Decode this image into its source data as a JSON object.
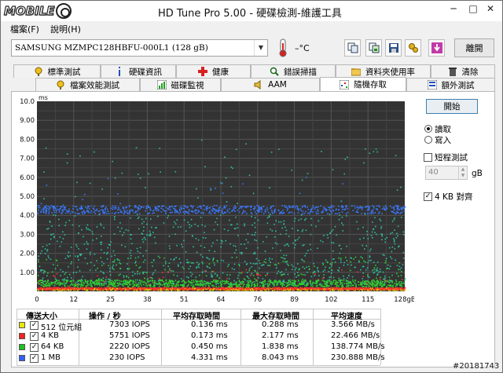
{
  "app": {
    "title": "HD Tune Pro  5.00 - 硬碟檢測-維護工具",
    "logo_text": "MOBILE",
    "window_controls": {
      "minimize": "─",
      "maximize": "□",
      "close": "✕"
    }
  },
  "menu": {
    "file": "檔案(F)",
    "help": "說明(H)"
  },
  "toolbar": {
    "drive": "SAMSUNG MZMPC128HBFU-000L1 (128 gB)",
    "temperature": "–°C",
    "exit_label": "離開",
    "icons": [
      "copy-icon",
      "copy-screenshot-icon",
      "save-icon",
      "options-icon",
      "download-icon"
    ]
  },
  "tabs": {
    "row1": [
      {
        "label": "標準測試",
        "icon": "benchmark-icon"
      },
      {
        "label": "硬碟資訊",
        "icon": "info-icon"
      },
      {
        "label": "健康",
        "icon": "health-icon"
      },
      {
        "label": "錯誤掃描",
        "icon": "scan-icon"
      },
      {
        "label": "資料夾使用率",
        "icon": "folder-icon"
      },
      {
        "label": "清除",
        "icon": "trash-icon"
      }
    ],
    "row2": [
      {
        "label": "檔案效能測試",
        "icon": "file-benchmark-icon"
      },
      {
        "label": "磁碟監視",
        "icon": "monitor-icon"
      },
      {
        "label": "AAM",
        "icon": "speaker-icon"
      },
      {
        "label": "隨機存取",
        "icon": "random-access-icon",
        "active": true
      },
      {
        "label": "額外測試",
        "icon": "extra-tests-icon"
      }
    ]
  },
  "controls": {
    "start": "開始",
    "read": "讀取",
    "write": "寫入",
    "short_stroke": "短程測試",
    "stroke_value": "40",
    "stroke_unit": "gB",
    "align": "4 KB 對齊",
    "read_selected": true,
    "align_checked": true
  },
  "chart_data": {
    "type": "scatter",
    "ylabel": "ms",
    "ylim": [
      0,
      10
    ],
    "y_ticks": [
      "10.0",
      "9.00",
      "8.00",
      "7.00",
      "6.00",
      "5.00",
      "4.00",
      "3.00",
      "2.00",
      "1.00"
    ],
    "x_ticks": [
      "0",
      "12",
      "25",
      "38",
      "51",
      "64",
      "76",
      "89",
      "102",
      "115",
      "128gB"
    ],
    "xlim": [
      0,
      128
    ],
    "background": "#333333",
    "grid": true,
    "series": [
      {
        "name": "512 位元組",
        "color": "#e8e800",
        "band_ms": 0.14,
        "max_ms": 0.29
      },
      {
        "name": "4 KB",
        "color": "#ff3030",
        "band_ms": 0.17,
        "max_ms": 2.18
      },
      {
        "name": "64 KB",
        "color": "#30d030",
        "band_ms": 0.45,
        "max_ms": 1.84
      },
      {
        "name": "1 MB",
        "color": "#3a78ff",
        "band_ms": 4.33,
        "max_ms": 8.04
      }
    ],
    "scatter_color": "#2fbf9f"
  },
  "results": {
    "headers": [
      "傳送大小",
      "操作 / 秒",
      "平均存取時間",
      "最大存取時間",
      "平均速度"
    ],
    "rows": [
      {
        "size": "512 位元組",
        "ops": "7303 IOPS",
        "avg": "0.136 ms",
        "max": "0.288 ms",
        "speed": "3.566 MB/s",
        "color": "#e8e800"
      },
      {
        "size": "4 KB",
        "ops": "5751 IOPS",
        "avg": "0.173 ms",
        "max": "2.177 ms",
        "speed": "22.466 MB/s",
        "color": "#ff2020"
      },
      {
        "size": "64 KB",
        "ops": "2220 IOPS",
        "avg": "0.450 ms",
        "max": "1.838 ms",
        "speed": "138.774 MB/s",
        "color": "#20c020"
      },
      {
        "size": "1 MB",
        "ops": "230 IOPS",
        "avg": "4.331 ms",
        "max": "8.043 ms",
        "speed": "230.888 MB/s",
        "color": "#3060ff"
      }
    ]
  },
  "watermark": "#20181743"
}
